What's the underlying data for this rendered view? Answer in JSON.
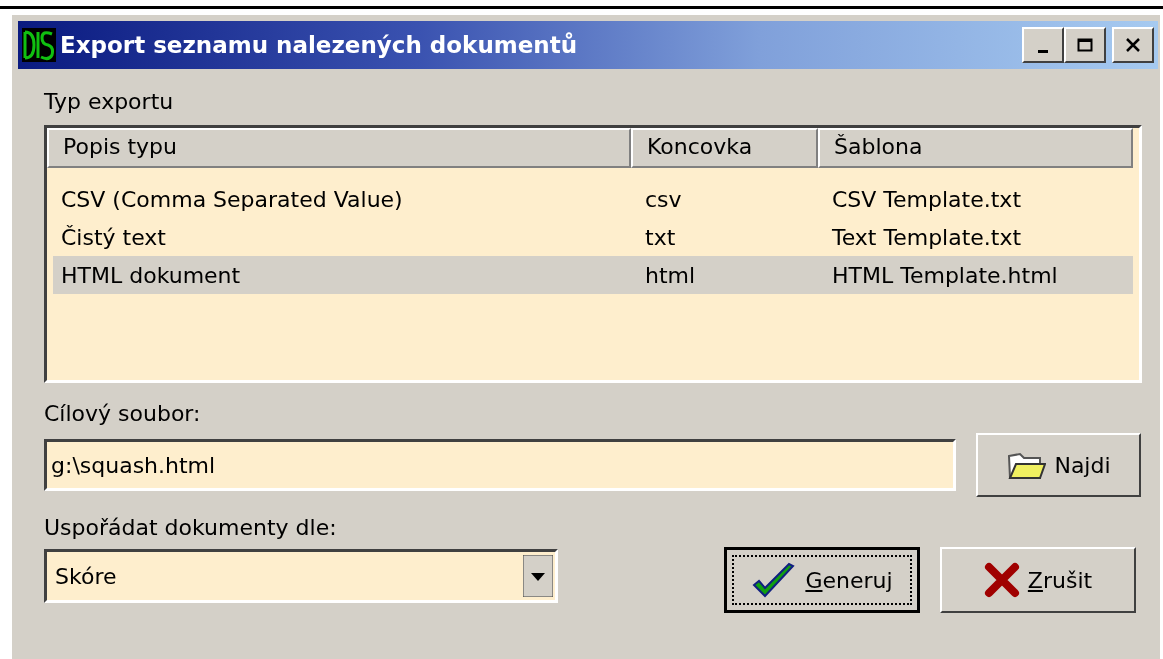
{
  "window": {
    "title": "Export seznamu nalezených dokumentů"
  },
  "export_type": {
    "label": "Typ exportu",
    "columns": [
      "Popis typu",
      "Koncovka",
      "Šablona"
    ],
    "rows": [
      {
        "cells": [
          "CSV (Comma Separated Value)",
          "csv",
          "CSV Template.txt"
        ],
        "selected": false
      },
      {
        "cells": [
          "Čistý text",
          "txt",
          "Text Template.txt"
        ],
        "selected": false
      },
      {
        "cells": [
          "HTML dokument",
          "html",
          "HTML Template.html"
        ],
        "selected": true
      }
    ]
  },
  "target_file": {
    "label": "Cílový soubor:",
    "value": "g:\\squash.html"
  },
  "browse_button": {
    "label": "Najdi"
  },
  "sort_by": {
    "label": "Uspořádat dokumenty dle:",
    "value": "Skóre"
  },
  "buttons": [
    {
      "kind": "ok",
      "access_key": "G",
      "label_rest": "eneruj",
      "focused": true
    },
    {
      "kind": "cancel",
      "access_key": "Z",
      "label_rest": "rušit",
      "focused": false
    }
  ]
}
